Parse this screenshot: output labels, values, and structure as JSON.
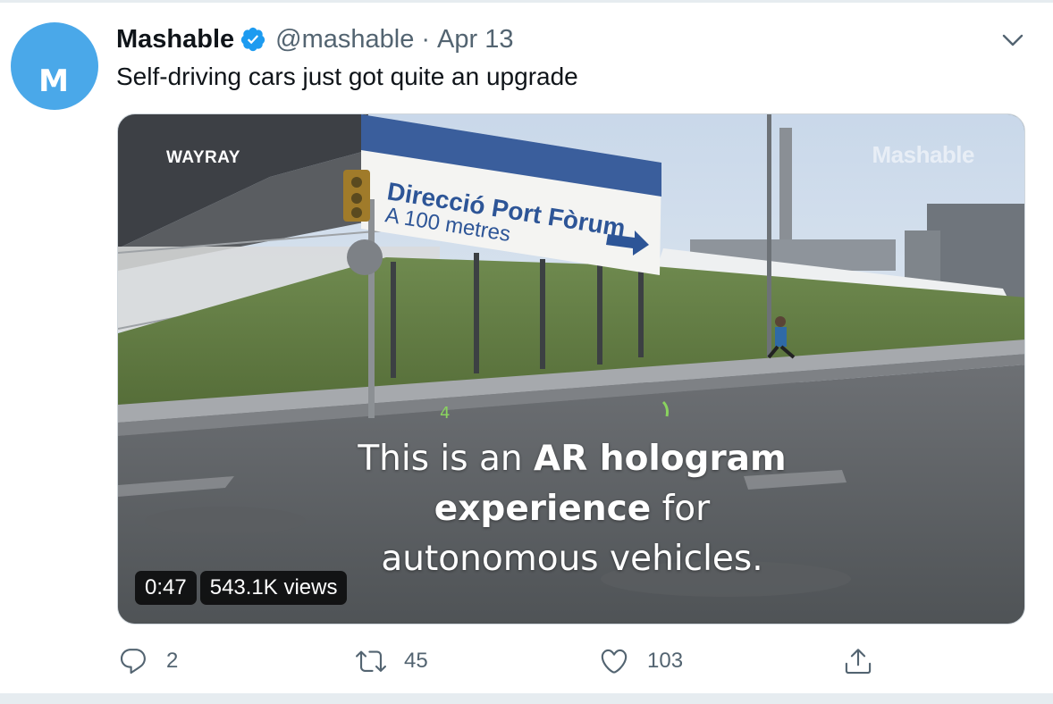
{
  "tweet": {
    "avatar_letter": "M",
    "display_name": "Mashable",
    "handle": "@mashable",
    "separator": "·",
    "date": "Apr 13",
    "text": "Self-driving cars just got quite an upgrade"
  },
  "media": {
    "overlay_brand": "WAYRAY",
    "watermark": "Mashable",
    "sign_text_line1": "Direcció Port Fòrum",
    "sign_text_line2": "A 100 metres",
    "caption_line1_pre": "This is an ",
    "caption_line1_bold": "AR hologram",
    "caption_line2_bold": "experience",
    "caption_line2_post": " for",
    "caption_line3": "autonomous vehicles.",
    "duration": "0:47",
    "views": "543.1K views"
  },
  "actions": {
    "reply_count": "2",
    "retweet_count": "45",
    "like_count": "103"
  },
  "icons": {
    "verified": "verified-badge-icon",
    "caret": "chevron-down-icon",
    "reply": "reply-icon",
    "retweet": "retweet-icon",
    "like": "heart-icon",
    "share": "share-icon"
  },
  "colors": {
    "verified_blue": "#1d9bf0",
    "avatar_blue": "#4aa8e9",
    "muted_text": "#536471",
    "text": "#0f1419"
  }
}
